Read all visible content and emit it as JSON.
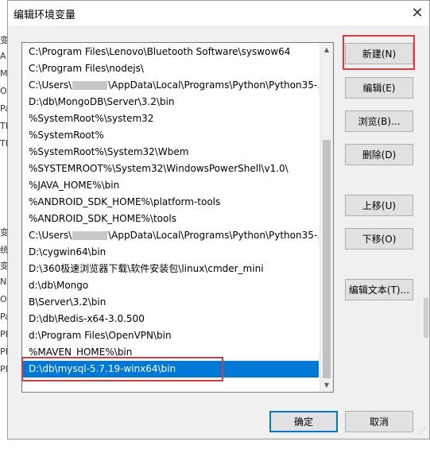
{
  "background_fragments": [
    "变",
    "A",
    "M",
    "O",
    "Pa",
    "TE",
    "TM",
    "变",
    "统",
    "变",
    "N",
    "O",
    "Pa",
    "PF",
    "PF",
    "PF"
  ],
  "dialog": {
    "title": "编辑环境变量",
    "close_glyph": "✕"
  },
  "path_list": {
    "items": [
      {
        "pre": "C:\\Program Files\\Lenovo\\Bluetooth Software\\syswow64",
        "blurred": false,
        "post": ""
      },
      {
        "pre": "C:\\Program Files\\nodejs\\",
        "blurred": false,
        "post": ""
      },
      {
        "pre": "C:\\Users\\",
        "blurred": true,
        "post": "\\AppData\\Local\\Programs\\Python\\Python35-..."
      },
      {
        "pre": "D:\\db\\MongoDB\\Server\\3.2\\bin",
        "blurred": false,
        "post": ""
      },
      {
        "pre": "%SystemRoot%\\system32",
        "blurred": false,
        "post": ""
      },
      {
        "pre": "%SystemRoot%",
        "blurred": false,
        "post": ""
      },
      {
        "pre": "%SystemRoot%\\System32\\Wbem",
        "blurred": false,
        "post": ""
      },
      {
        "pre": "%SYSTEMROOT%\\System32\\WindowsPowerShell\\v1.0\\",
        "blurred": false,
        "post": ""
      },
      {
        "pre": "%JAVA_HOME%\\bin",
        "blurred": false,
        "post": ""
      },
      {
        "pre": "%ANDROID_SDK_HOME%\\platform-tools",
        "blurred": false,
        "post": ""
      },
      {
        "pre": "%ANDROID_SDK_HOME%\\tools",
        "blurred": false,
        "post": ""
      },
      {
        "pre": "C:\\Users\\",
        "blurred": true,
        "post": "\\AppData\\Local\\Programs\\Python\\Python35-..."
      },
      {
        "pre": "D:\\cygwin64\\bin",
        "blurred": false,
        "post": ""
      },
      {
        "pre": "D:\\360极速浏览器下载\\软件安装包\\linux\\cmder_mini",
        "blurred": false,
        "post": ""
      },
      {
        "pre": "d:\\db\\Mongo",
        "blurred": false,
        "post": ""
      },
      {
        "pre": "B\\Server\\3.2\\bin",
        "blurred": false,
        "post": ""
      },
      {
        "pre": "D:\\db\\Redis-x64-3.0.500",
        "blurred": false,
        "post": ""
      },
      {
        "pre": "d:\\Program Files\\OpenVPN\\bin",
        "blurred": false,
        "post": ""
      },
      {
        "pre": "%MAVEN_HOME%\\bin",
        "blurred": false,
        "post": ""
      },
      {
        "pre": "D:\\db\\mysql-5.7.19-winx64\\bin",
        "blurred": false,
        "post": "",
        "selected": true
      }
    ],
    "scroll_up_glyph": "▲",
    "scroll_down_glyph": "▼"
  },
  "buttons": {
    "new": "新建(N)",
    "edit": "编辑(E)",
    "browse": "浏览(B)...",
    "delete": "删除(D)",
    "move_up": "上移(U)",
    "move_down": "下移(O)",
    "edit_text": "编辑文本(T)...",
    "ok": "确定",
    "cancel": "取消"
  },
  "colors": {
    "selection": "#0078d7",
    "highlight_box": "#e0393e"
  }
}
